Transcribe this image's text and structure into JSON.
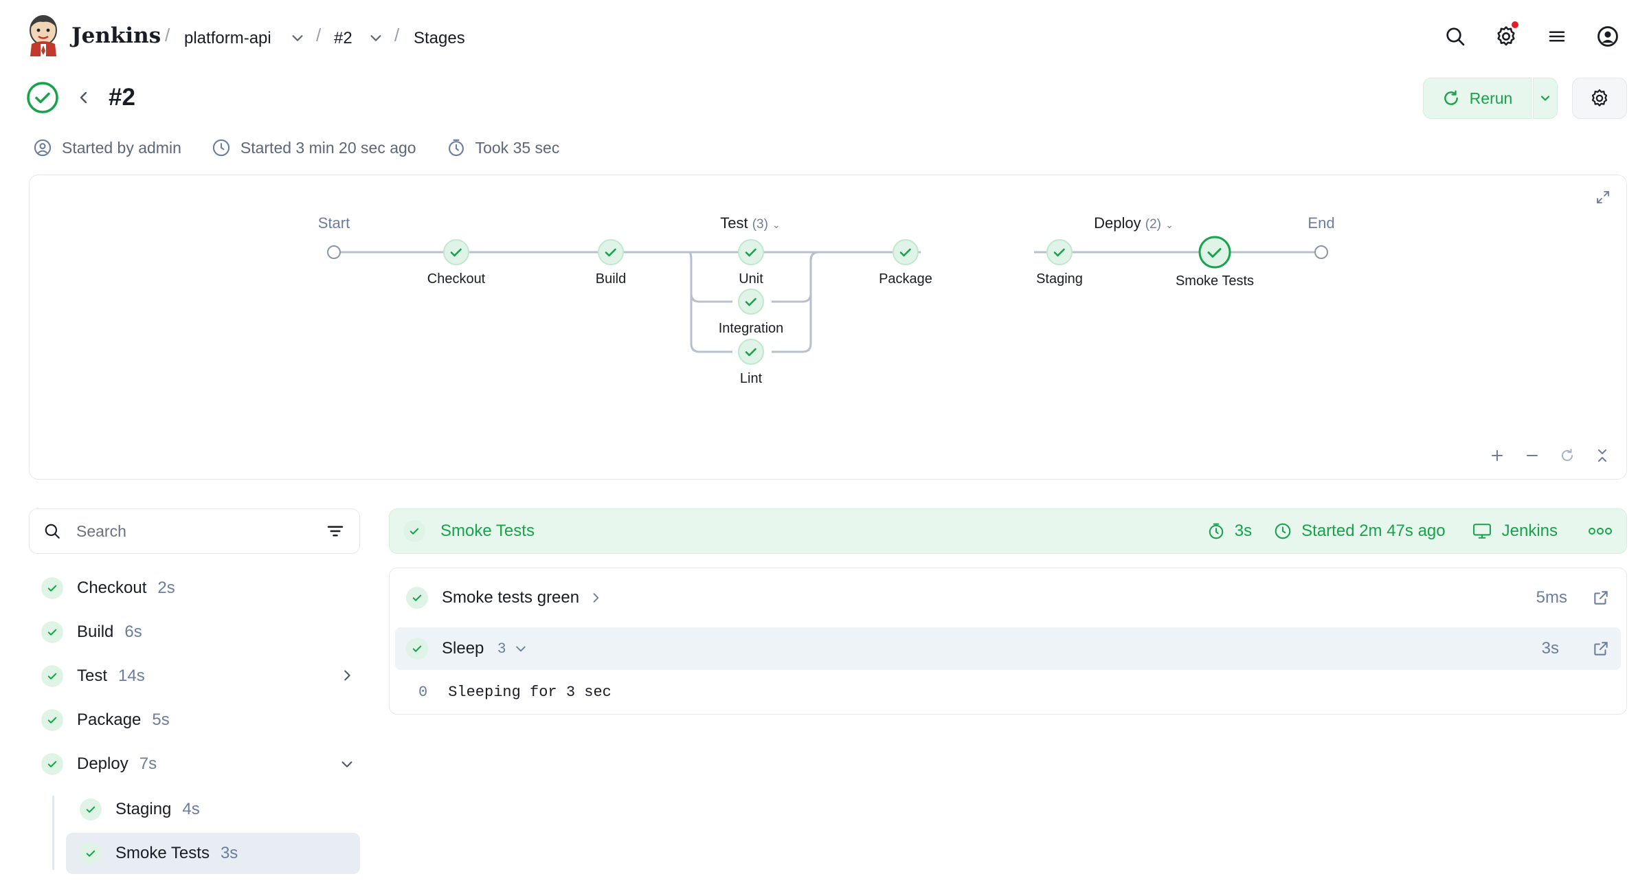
{
  "brand": {
    "name": "Jenkins"
  },
  "breadcrumb": {
    "project": "platform-api",
    "run": "#2",
    "page": "Stages"
  },
  "run": {
    "title": "#2",
    "started_by": "Started by admin",
    "started_at": "Started 3 min 20 sec ago",
    "took": "Took 35 sec",
    "rerun_label": "Rerun"
  },
  "graph": {
    "start_label": "Start",
    "end_label": "End",
    "test_group": {
      "name": "Test",
      "count": "(3)"
    },
    "deploy_group": {
      "name": "Deploy",
      "count": "(2)"
    },
    "nodes": {
      "checkout": "Checkout",
      "build": "Build",
      "unit": "Unit",
      "integration": "Integration",
      "lint": "Lint",
      "package": "Package",
      "staging": "Staging",
      "smoke": "Smoke Tests"
    }
  },
  "search": {
    "placeholder": "Search"
  },
  "stages": [
    {
      "name": "Checkout",
      "duration": "2s"
    },
    {
      "name": "Build",
      "duration": "6s"
    },
    {
      "name": "Test",
      "duration": "14s"
    },
    {
      "name": "Package",
      "duration": "5s"
    },
    {
      "name": "Deploy",
      "duration": "7s"
    },
    {
      "name": "Staging",
      "duration": "4s"
    },
    {
      "name": "Smoke Tests",
      "duration": "3s"
    }
  ],
  "selected_stage": {
    "name": "Smoke Tests",
    "duration": "3s",
    "started": "Started 2m 47s ago",
    "agent": "Jenkins"
  },
  "steps": [
    {
      "name": "Smoke tests green",
      "duration": "5ms"
    },
    {
      "name": "Sleep",
      "count": "3",
      "duration": "3s"
    }
  ],
  "log": [
    {
      "line": "0",
      "text": "Sleeping for 3 sec"
    }
  ],
  "colors": {
    "success": "#16a34a",
    "success_bg": "#e8f7ee",
    "connector": "#b7c0cc"
  }
}
